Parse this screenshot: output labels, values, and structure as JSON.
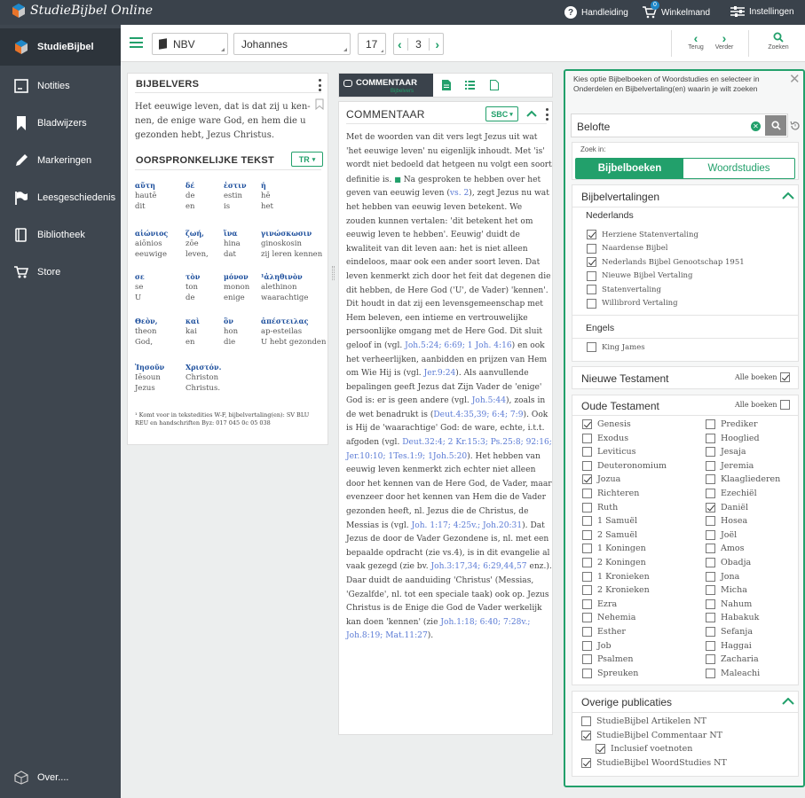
{
  "app": {
    "title": "StudieBijbel Online"
  },
  "topbar": {
    "help": "Handleiding",
    "cart": "Winkelmand",
    "cart_count": "0",
    "settings": "Instellingen"
  },
  "sidebar": {
    "items": [
      {
        "label": "StudieBijbel",
        "icon": "studiebijbel-logo-icon"
      },
      {
        "label": "Notities",
        "icon": "note-icon"
      },
      {
        "label": "Bladwijzers",
        "icon": "bookmark-icon"
      },
      {
        "label": "Markeringen",
        "icon": "pen-icon"
      },
      {
        "label": "Leesgeschiedenis",
        "icon": "history-flag-icon"
      },
      {
        "label": "Bibliotheek",
        "icon": "library-icon"
      },
      {
        "label": "Store",
        "icon": "cart-icon"
      }
    ],
    "about": "Over...."
  },
  "toolbar": {
    "translation": "NBV",
    "book": "Johannes",
    "chapter": "17",
    "verse": "3",
    "back": "Terug",
    "forward": "Verder",
    "search": "Zoeken"
  },
  "verse_panel": {
    "title": "BIJBELVERS",
    "text": "Het eeuwige leven, dat is dat zij u ken-nen, de enige ware God, en hem die u gezonden hebt, Jezus Christus.",
    "original_title": "OORSPRONKELIJKE TEKST",
    "original_badge": "TR",
    "greek": [
      {
        "g": "αὕτη",
        "t1": "hautē",
        "t2": "dit"
      },
      {
        "g": "δέ",
        "t1": "de",
        "t2": "en"
      },
      {
        "g": "ἐστιν",
        "t1": "estin",
        "t2": "is"
      },
      {
        "g": "ἡ",
        "t1": "hē",
        "t2": "het"
      },
      {
        "g": "αἰώνιος",
        "t1": "aiōnios",
        "t2": "eeuwige"
      },
      {
        "g": "ζωή,",
        "t1": "zōe",
        "t2": "leven,"
      },
      {
        "g": "ἵνα",
        "t1": "hina",
        "t2": "dat"
      },
      {
        "g": "γινώσκωσιν",
        "t1": "ginoskosin",
        "t2": "zij leren kennen"
      },
      {
        "g": "σε",
        "t1": "se",
        "t2": "U"
      },
      {
        "g": "τὸν",
        "t1": "ton",
        "t2": "de"
      },
      {
        "g": "μόνον",
        "t1": "monon",
        "t2": "enige"
      },
      {
        "g": "¹ἀληθινὸν",
        "t1": "alethinon",
        "t2": "waarachtige"
      },
      {
        "g": "Θεὸν,",
        "t1": "theon",
        "t2": "God,"
      },
      {
        "g": "καὶ",
        "t1": "kai",
        "t2": "en"
      },
      {
        "g": "ὃν",
        "t1": "hon",
        "t2": "die"
      },
      {
        "g": "ἀπέστειλας",
        "t1": "ap-esteilas",
        "t2": "U hebt gezonden"
      },
      {
        "g": "Ἰησοῦν",
        "t1": "Iēsoun",
        "t2": "Jezus"
      },
      {
        "g": "Χριστόν.",
        "t1": "Christon",
        "t2": "Christus."
      }
    ],
    "footnote": "¹ Komt voor in tekstedities W-F, bijbelvertaling(en): SV BLU REU en handschriften Byz: 017 045 0c 05 038"
  },
  "commentary_tabs": {
    "active": "COMMENTAAR",
    "active_sub": "Bijbelvers"
  },
  "commentary": {
    "title": "COMMENTAAR",
    "badge": "SBC",
    "body": [
      {
        "t": "Met de woorden van dit vers legt Jezus uit wat 'het eeuwige leven' nu eigenlijk inhoudt. Met 'is' wordt niet bedoeld dat hetgeen nu volgt een soort definitie is. "
      },
      {
        "t": "■",
        "c": "note"
      },
      {
        "t": " Na gesproken te hebben over het geven van eeuwig leven ("
      },
      {
        "t": "vs. 2",
        "c": "link"
      },
      {
        "t": "), zegt Jezus nu wat het hebben van eeuwig leven betekent. We zouden kunnen vertalen: 'dit betekent het om eeuwig leven te hebben'. Eeuwig' duidt de kwaliteit van dit leven aan: het is niet alleen eindeloos, maar ook een ander soort leven. Dat leven kenmerkt zich door het feit dat degenen die dit hebben, de Here God ('U', de Vader) 'kennen'. Dit houdt in dat zij een levensgemeenschap met Hem beleven, een intieme en vertrouwelijke persoonlijke omgang met de Here God. Dit sluit geloof in (vgl. "
      },
      {
        "t": "Joh.5:24; 6:69; 1 Joh. 4:16",
        "c": "link"
      },
      {
        "t": ") en ook het verheerlijken, aanbidden en prijzen van Hem om Wie Hij is (vgl. "
      },
      {
        "t": "Jer.9:24",
        "c": "link"
      },
      {
        "t": "). Als aanvullende bepalingen geeft Jezus dat Zijn Vader de 'enige' God is: er is geen andere (vgl. "
      },
      {
        "t": "Joh.5:44",
        "c": "link"
      },
      {
        "t": "), zoals in de wet benadrukt is ("
      },
      {
        "t": "Deut.4:35,39; 6:4; 7:9",
        "c": "link"
      },
      {
        "t": "). Ook is Hij de 'waarachtige' God: de ware, echte, i.t.t. afgoden (vgl. "
      },
      {
        "t": "Deut.32:4; 2 Kr.15:3; Ps.25:8; 92:16; Jer.10:10; 1Tes.1:9; 1Joh.5:20",
        "c": "link"
      },
      {
        "t": "). Het hebben van eeuwig leven kenmerkt zich echter niet alleen door het kennen van de Here God, de Vader, maar evenzeer door het kennen van Hem die de Vader gezonden heeft, nl. Jezus die de Christus, de Messias is (vgl. "
      },
      {
        "t": "Joh. 1:17; 4:25v.; Joh.20:31",
        "c": "link"
      },
      {
        "t": "). Dat Jezus de door de Vader Gezondene is, nl. met een bepaalde opdracht (zie vs.4), is in dit evangelie al vaak gezegd (zie bv. "
      },
      {
        "t": "Joh.3:17,34; 6:29,44,57",
        "c": "link"
      },
      {
        "t": " enz.). Daar duidt de aanduiding 'Christus' (Messias, 'Gezalfde', nl. tot een speciale taak) ook op. Jezus Christus is de Enige die God de Vader werkelijk kan doen 'kennen' (zie "
      },
      {
        "t": "Joh.1:18; 6:40; 7:28v.; Joh.8:19; Mat.11:27",
        "c": "link"
      },
      {
        "t": ")."
      }
    ]
  },
  "search_panel": {
    "instructions": "Kies optie Bijbelboeken of Woordstudies en selecteer in Onderdelen en Bijbelvertaling(en) waarin je wilt zoeken",
    "query": "Belofte",
    "search_in": "Zoek in:",
    "tab_books": "Bijbelboeken",
    "tab_words": "Woordstudies",
    "translations_title": "Bijbelvertalingen",
    "dutch_label": "Nederlands",
    "dutch": [
      {
        "label": "Herziene Statenvertaling",
        "checked": true
      },
      {
        "label": "Naardense Bijbel",
        "checked": false
      },
      {
        "label": "Nederlands Bijbel Genootschap 1951",
        "checked": true
      },
      {
        "label": "Nieuwe Bijbel Vertaling",
        "checked": false
      },
      {
        "label": "Statenvertaling",
        "checked": false
      },
      {
        "label": "Willibrord Vertaling",
        "checked": false
      }
    ],
    "english_label": "Engels",
    "english": [
      {
        "label": "King James",
        "checked": false
      }
    ],
    "nt_title": "Nieuwe Testament",
    "all_books": "Alle boeken",
    "nt_all_checked": true,
    "ot_title": "Oude Testament",
    "ot_all_checked": false,
    "ot_books_col1": [
      {
        "label": "Genesis",
        "checked": true
      },
      {
        "label": "Exodus",
        "checked": false
      },
      {
        "label": "Leviticus",
        "checked": false
      },
      {
        "label": "Deuteronomium",
        "checked": false
      },
      {
        "label": "Jozua",
        "checked": true
      },
      {
        "label": "Richteren",
        "checked": false
      },
      {
        "label": "Ruth",
        "checked": false
      },
      {
        "label": "1 Samuël",
        "checked": false
      },
      {
        "label": "2 Samuël",
        "checked": false
      },
      {
        "label": "1 Koningen",
        "checked": false
      },
      {
        "label": "2 Koningen",
        "checked": false
      },
      {
        "label": "1 Kronieken",
        "checked": false
      },
      {
        "label": "2 Kronieken",
        "checked": false
      },
      {
        "label": "Ezra",
        "checked": false
      },
      {
        "label": "Nehemia",
        "checked": false
      },
      {
        "label": "Esther",
        "checked": false
      },
      {
        "label": "Job",
        "checked": false
      },
      {
        "label": "Psalmen",
        "checked": false
      },
      {
        "label": "Spreuken",
        "checked": false
      }
    ],
    "ot_books_col2": [
      {
        "label": "Prediker",
        "checked": false
      },
      {
        "label": "Hooglied",
        "checked": false
      },
      {
        "label": "Jesaja",
        "checked": false
      },
      {
        "label": "Jeremia",
        "checked": false
      },
      {
        "label": "Klaagliederen",
        "checked": false
      },
      {
        "label": "Ezechiël",
        "checked": false
      },
      {
        "label": "Daniël",
        "checked": true
      },
      {
        "label": "Hosea",
        "checked": false
      },
      {
        "label": "Joël",
        "checked": false
      },
      {
        "label": "Amos",
        "checked": false
      },
      {
        "label": "Obadja",
        "checked": false
      },
      {
        "label": "Jona",
        "checked": false
      },
      {
        "label": "Micha",
        "checked": false
      },
      {
        "label": "Nahum",
        "checked": false
      },
      {
        "label": "Habakuk",
        "checked": false
      },
      {
        "label": "Sefanja",
        "checked": false
      },
      {
        "label": "Haggai",
        "checked": false
      },
      {
        "label": "Zacharia",
        "checked": false
      },
      {
        "label": "Maleachi",
        "checked": false
      }
    ],
    "other_title": "Overige publicaties",
    "other": [
      {
        "label": "StudieBijbel Artikelen NT",
        "checked": false
      },
      {
        "label": "StudieBijbel Commentaar NT",
        "checked": true
      },
      {
        "label": "Inclusief voetnoten",
        "checked": true,
        "indent": true
      },
      {
        "label": "StudieBijbel WoordStudies NT",
        "checked": true
      }
    ]
  },
  "colors": {
    "accent": "#22a06b",
    "dark": "#3a424b",
    "sidebar": "#3e464f",
    "link": "#5b7bd5",
    "greek": "#1c4e9c"
  }
}
